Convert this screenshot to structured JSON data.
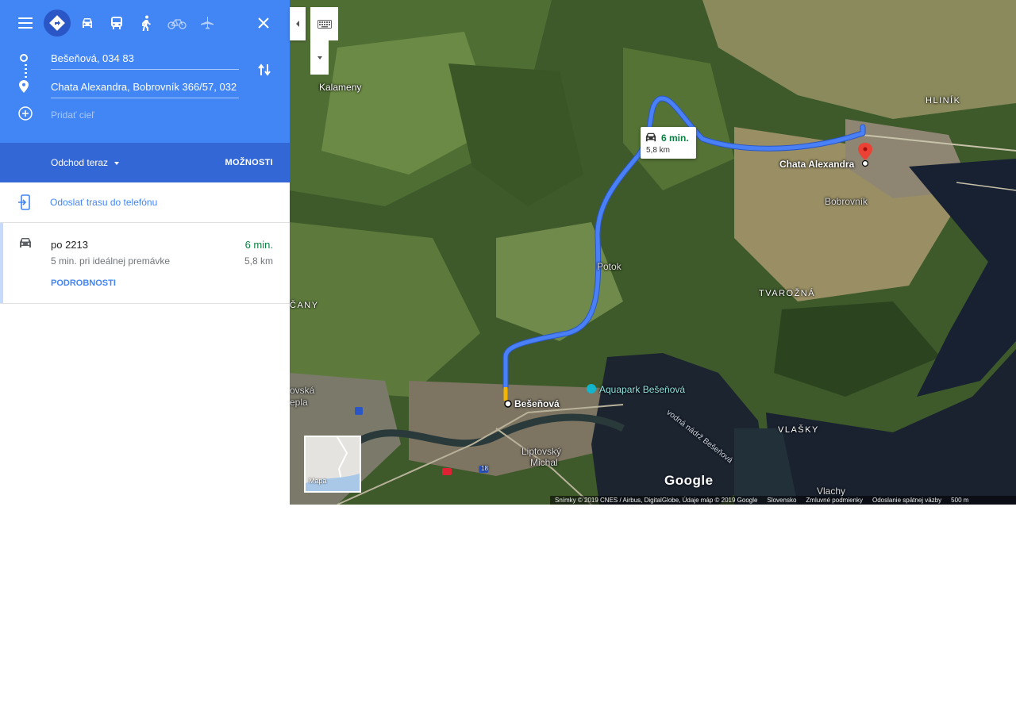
{
  "header": {
    "modes": [
      {
        "name": "menu-icon",
        "active": false
      },
      {
        "name": "directions-icon",
        "active": true
      },
      {
        "name": "car-icon",
        "active": false
      },
      {
        "name": "transit-icon",
        "active": false
      },
      {
        "name": "walking-icon",
        "active": false
      },
      {
        "name": "bicycle-icon",
        "active": false
      },
      {
        "name": "flight-icon",
        "active": false
      }
    ],
    "origin": "Bešeňová, 034 83",
    "destination": "Chata Alexandra, Bobrovník 366/57, 032",
    "add_destination_placeholder": "Pridať cieľ",
    "depart_label": "Odchod teraz",
    "options_label": "MOŽNOSTI",
    "colors": {
      "header_bg": "#4285f4",
      "subbar_bg": "#3367d6"
    }
  },
  "send_to_phone": "Odoslať trasu do telefónu",
  "route": {
    "via": "po 2213",
    "time": "6 min.",
    "note": "5 min. pri ideálnej premávke",
    "distance": "5,8 km",
    "details_label": "PODROBNOSTI",
    "time_color": "#0b8043"
  },
  "map": {
    "callout": {
      "time": "6 min.",
      "distance": "5,8 km"
    },
    "labels": {
      "kalameny": "Kalameny",
      "hlinik": "HLINÍK",
      "chata": "Chata Alexandra",
      "bobrovnik": "Bobrovník",
      "potok": "Potok",
      "tvarozna": "TVAROŽNÁ",
      "cany": "ČANY",
      "beseňova": "Bešeňová",
      "aquapark": "Aquapark Bešeňová",
      "nadrz": "vodná nádrž Bešeňová",
      "vlasky": "VLAŠKY",
      "liptovsky": "Liptovský",
      "michal": "Michal",
      "vlachy": "Vlachy",
      "ovska": "ovská",
      "epla": "epla",
      "road_18": "18"
    },
    "minimap_label": "Mapa",
    "logo": "Google",
    "footer": {
      "imagery": "Snímky © 2019 CNES / Airbus, DigitalGlobe, Údaje máp © 2019 Google",
      "country": "Slovensko",
      "terms": "Zmluvné podmienky",
      "feedback": "Odoslanie spätnej väzby",
      "scale": "500 m"
    },
    "route_color": "#4a80f5"
  }
}
